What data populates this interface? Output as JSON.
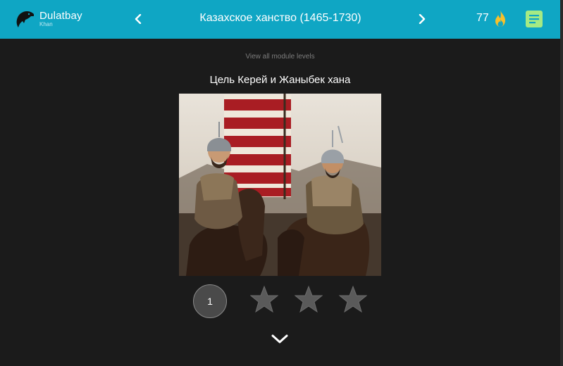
{
  "app": {
    "name": "Dulatbay",
    "subtitle": "Khan"
  },
  "header": {
    "module_title": "Казахское ханство (1465-1730)",
    "streak_count": "77",
    "icons": {
      "logo": "eagle-head-icon",
      "prev": "chevron-left-icon",
      "next": "chevron-right-icon",
      "streak": "flame-icon",
      "notes": "notes-icon"
    }
  },
  "main": {
    "view_all_label": "View all module levels",
    "level_title": "Цель Керей и Жаныбек хана",
    "level_number": "1",
    "stars_earned": 0,
    "stars_total": 3,
    "expand_icon": "chevron-down-icon"
  },
  "colors": {
    "header_bg": "#0fa6c4",
    "page_bg": "#1b1b1b",
    "flame": "#f7c02a",
    "notes": "#a5ea84",
    "star": "#5a5a5a"
  }
}
